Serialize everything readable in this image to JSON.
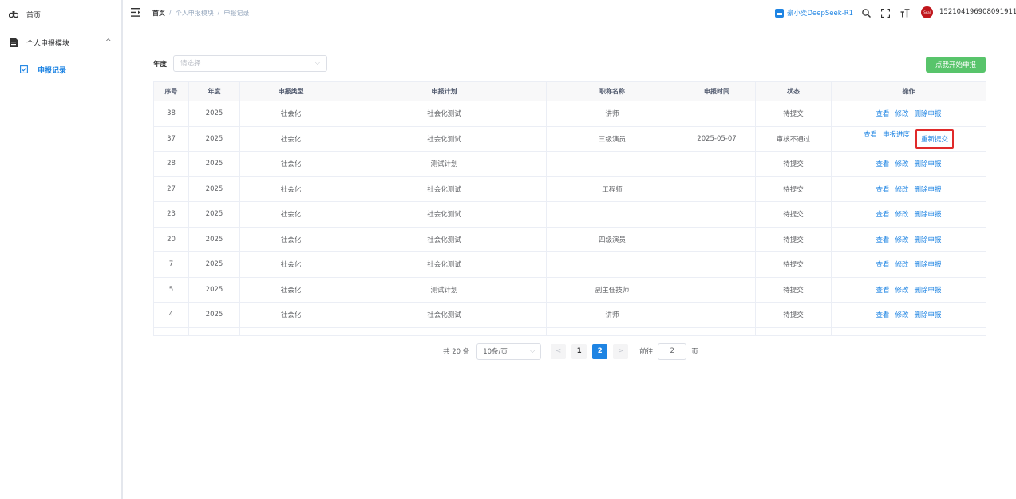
{
  "sidebar": {
    "home": "首页",
    "module": "个人申报模块",
    "module_chevron": "^",
    "record": "申报记录"
  },
  "header": {
    "breadcrumb": [
      "首页",
      "/",
      "个人申报模块",
      "/",
      "申报记录"
    ],
    "assistant": "豪小奕DeepSeek-R1",
    "avatar_text": "Seal",
    "user_id": "152104196908091911"
  },
  "filter": {
    "label": "年度",
    "placeholder": "请选择",
    "start_button": "点我开始申报"
  },
  "table": {
    "columns": [
      "序号",
      "年度",
      "申报类型",
      "申报计划",
      "职称名称",
      "申报时间",
      "状态",
      "操作"
    ],
    "rows": [
      {
        "id": "38",
        "year": "2025",
        "type": "社会化",
        "plan": "社会化测试",
        "title": "讲师",
        "time": "",
        "status": "待提交",
        "ops": [
          "查看",
          "修改",
          "删除申报"
        ]
      },
      {
        "id": "37",
        "year": "2025",
        "type": "社会化",
        "plan": "社会化测试",
        "title": "三级演员",
        "time": "2025-05-07",
        "status": "审核不通过",
        "ops": [
          "查看",
          "申报进度",
          "重新提交"
        ]
      },
      {
        "id": "28",
        "year": "2025",
        "type": "社会化",
        "plan": "测试计划",
        "title": "",
        "time": "",
        "status": "待提交",
        "ops": [
          "查看",
          "修改",
          "删除申报"
        ]
      },
      {
        "id": "27",
        "year": "2025",
        "type": "社会化",
        "plan": "社会化测试",
        "title": "工程师",
        "time": "",
        "status": "待提交",
        "ops": [
          "查看",
          "修改",
          "删除申报"
        ]
      },
      {
        "id": "23",
        "year": "2025",
        "type": "社会化",
        "plan": "社会化测试",
        "title": "",
        "time": "",
        "status": "待提交",
        "ops": [
          "查看",
          "修改",
          "删除申报"
        ]
      },
      {
        "id": "20",
        "year": "2025",
        "type": "社会化",
        "plan": "社会化测试",
        "title": "四级演员",
        "time": "",
        "status": "待提交",
        "ops": [
          "查看",
          "修改",
          "删除申报"
        ]
      },
      {
        "id": "7",
        "year": "2025",
        "type": "社会化",
        "plan": "社会化测试",
        "title": "",
        "time": "",
        "status": "待提交",
        "ops": [
          "查看",
          "修改",
          "删除申报"
        ]
      },
      {
        "id": "5",
        "year": "2025",
        "type": "社会化",
        "plan": "测试计划",
        "title": "副主任技师",
        "time": "",
        "status": "待提交",
        "ops": [
          "查看",
          "修改",
          "删除申报"
        ]
      },
      {
        "id": "4",
        "year": "2025",
        "type": "社会化",
        "plan": "社会化测试",
        "title": "讲师",
        "time": "",
        "status": "待提交",
        "ops": [
          "查看",
          "修改",
          "删除申报"
        ]
      }
    ],
    "highlighted_op": "重新提交"
  },
  "pagination": {
    "total": "共 20 条",
    "page_size": "10条/页",
    "prev": "<",
    "pages": [
      "1",
      "2"
    ],
    "current": "2",
    "next": ">",
    "goto_label": "前往",
    "goto_value": "2",
    "page_suffix": "页"
  },
  "colors": {
    "primary": "#1e84e3",
    "success": "#58c46b",
    "highlight_border": "#e02a2a"
  }
}
